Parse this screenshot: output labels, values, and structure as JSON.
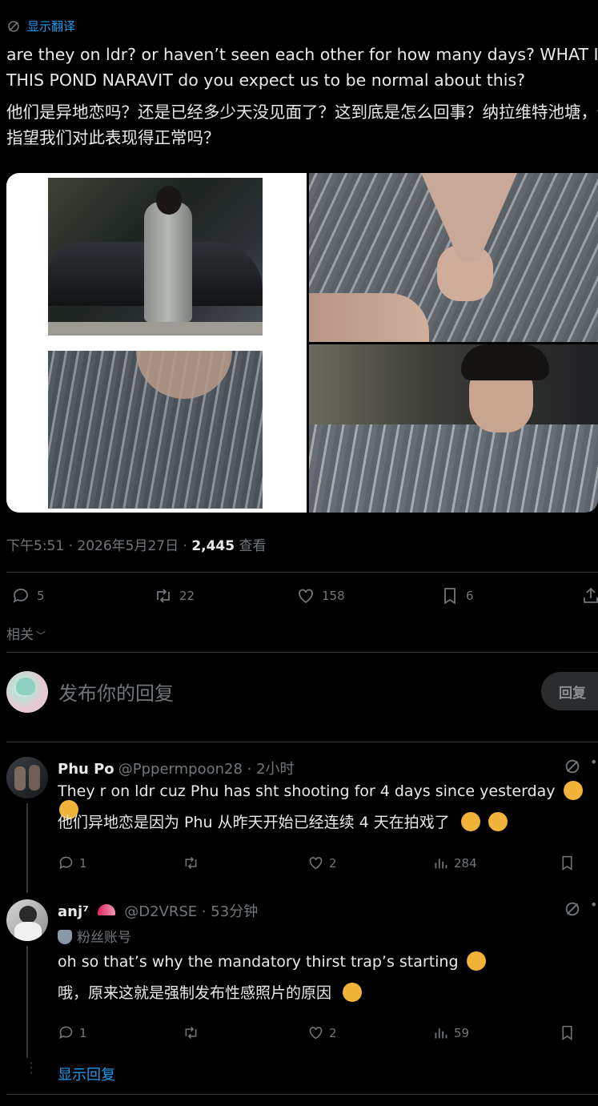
{
  "post": {
    "show_translation": "显示翻译",
    "text_en": "are they on ldr? or haven’t seen each other for how many days? WHAT IS THIS POND NARAVIT do you expect us to be normal about this?",
    "text_zh": "他们是异地恋吗？还是已经多少天没见面了？这到底是怎么回事？纳拉维特池塘，你指望我们对此表现得正常吗？",
    "time": "下午5:51 · 2026年5月27日 · ",
    "views_count": "2,445",
    "views_label": " 查看",
    "stats": {
      "replies": "5",
      "reposts": "22",
      "likes": "158",
      "bookmarks": "6"
    },
    "related_label": "相关"
  },
  "composer": {
    "placeholder": "发布你的回复",
    "button": "回复"
  },
  "comments": [
    {
      "name": "Phu Po",
      "handle": "@Pppermpoon28 · 2小时",
      "text_en": "They r on ldr cuz Phu has sht shooting for 4 days since yesterday",
      "text_zh": "他们异地恋是因为 Phu 从昨天开始已经连续 4 天在拍戏了",
      "replies": "1",
      "likes": "2",
      "views": "284"
    },
    {
      "name": "anj⁷",
      "handle": "@D2VRSE · 53分钟",
      "badge": "粉丝账号",
      "text_en": "oh so that’s why the mandatory thirst trap’s starting",
      "text_zh": "哦，原来这就是强制发布性感照片的原因",
      "replies": "1",
      "likes": "2",
      "views": "59"
    }
  ],
  "show_replies": "显示回复",
  "colors": {
    "accent": "#1d9bf0",
    "muted": "#71767b",
    "text": "#e7e9ea",
    "divider": "#2f3336"
  }
}
